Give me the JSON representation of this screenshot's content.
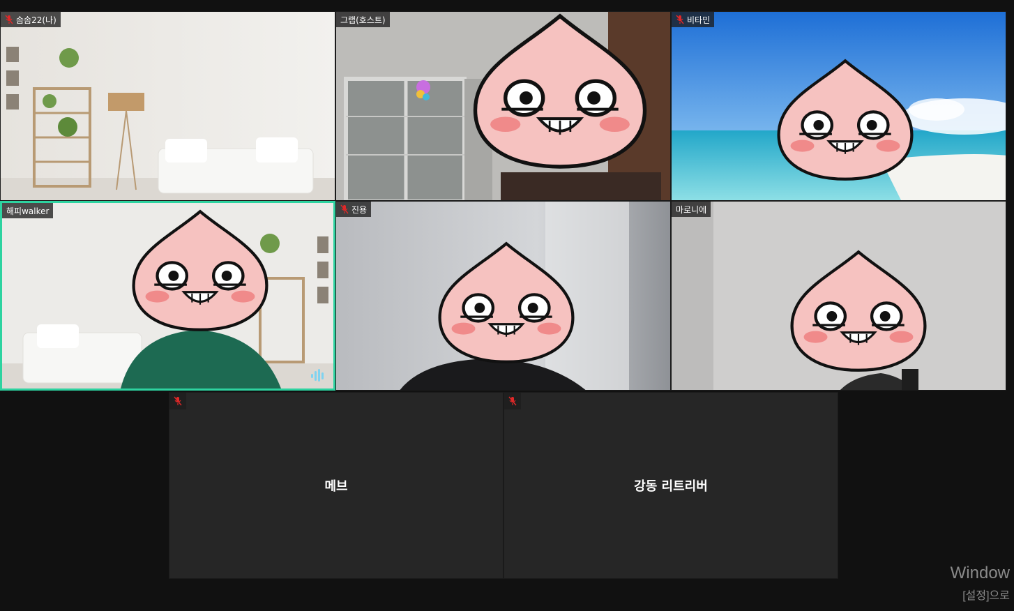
{
  "participants": [
    {
      "name": "솜솜22(나)",
      "muted": true,
      "background": "living-room"
    },
    {
      "name": "그랩(호스트)",
      "muted": false,
      "background": "window-room"
    },
    {
      "name": "비타민",
      "muted": true,
      "background": "beach"
    },
    {
      "name": "해피walker",
      "muted": false,
      "background": "living-room",
      "active_speaker": true
    },
    {
      "name": "진용",
      "muted": true,
      "background": "blurred-room"
    },
    {
      "name": "마로니에",
      "muted": false,
      "background": "plain-wall"
    },
    {
      "name": "메브",
      "muted": true,
      "video": "off"
    },
    {
      "name": "강동 리트리버",
      "muted": true,
      "video": "off"
    }
  ],
  "icons": {
    "muted_mic": "muted-mic-icon",
    "speaking": "audio-level-icon",
    "face_cover": "peach-emoji-icon"
  },
  "colors": {
    "active_border": "#2ed3a0",
    "mute_red": "#e02828",
    "tile_empty": "#262626",
    "background": "#111111"
  },
  "watermark": {
    "line1": "Window",
    "line2": "[설정]으로"
  }
}
